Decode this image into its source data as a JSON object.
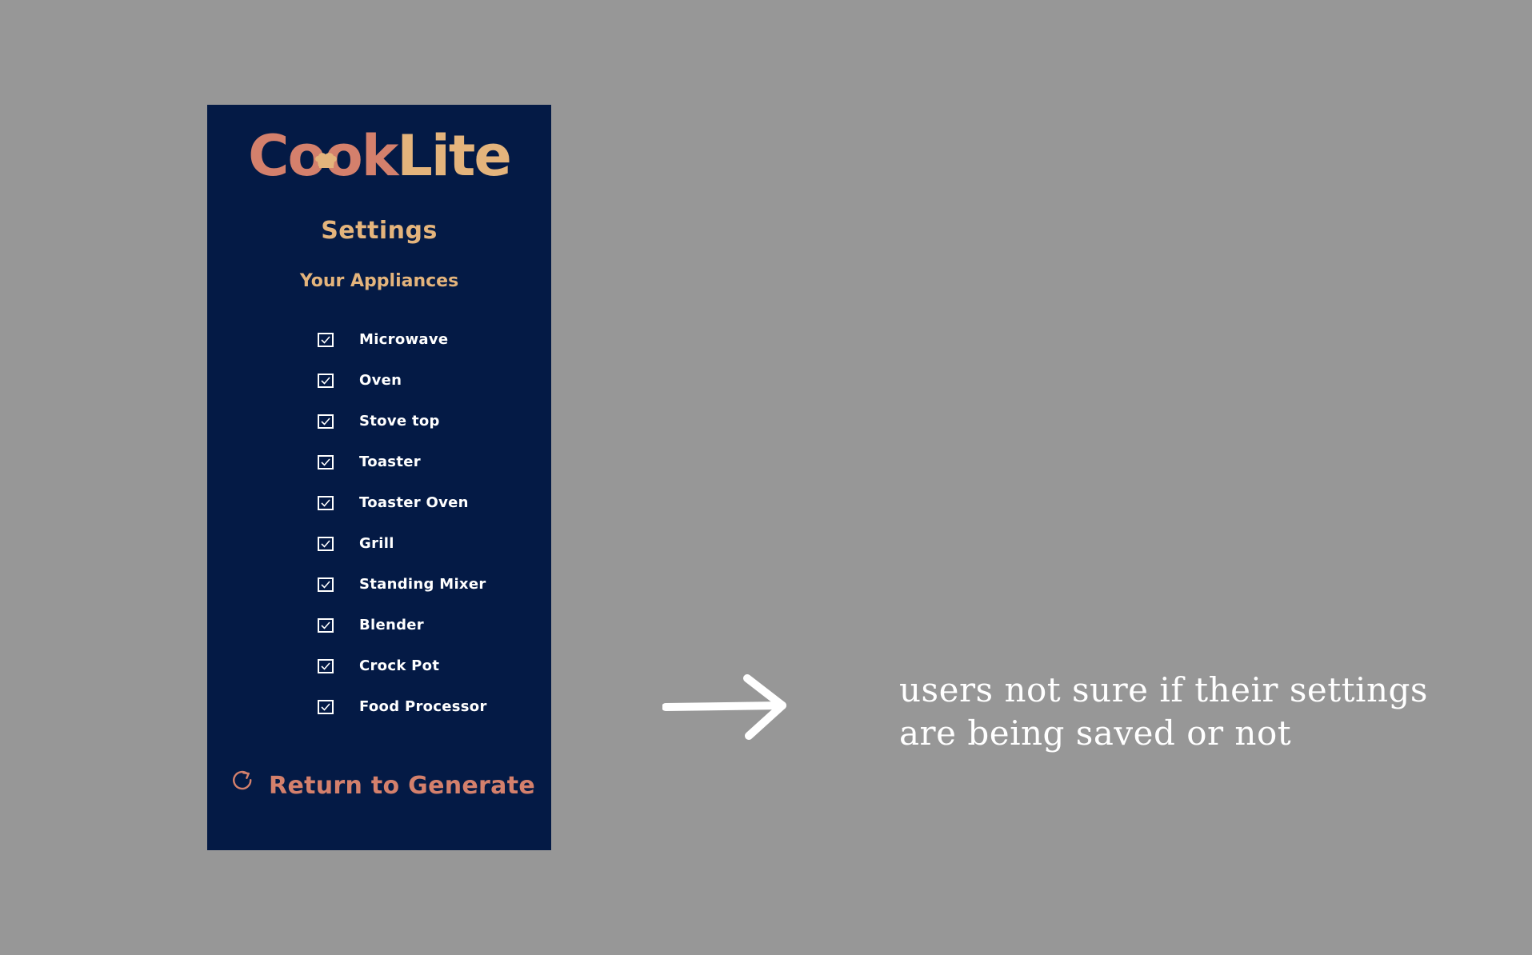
{
  "app": {
    "logo_part1": "Cook",
    "logo_part2": "Lite"
  },
  "settings": {
    "title": "Settings",
    "section_title": "Your Appliances",
    "appliances": [
      {
        "label": "Microwave",
        "checked": true
      },
      {
        "label": "Oven",
        "checked": true
      },
      {
        "label": "Stove top",
        "checked": true
      },
      {
        "label": "Toaster",
        "checked": true
      },
      {
        "label": "Toaster Oven",
        "checked": true
      },
      {
        "label": "Grill",
        "checked": true
      },
      {
        "label": "Standing Mixer",
        "checked": true
      },
      {
        "label": "Blender",
        "checked": true
      },
      {
        "label": "Crock Pot",
        "checked": true
      },
      {
        "label": "Food Processor",
        "checked": true
      }
    ],
    "return_label": "Return to Generate"
  },
  "annotation": {
    "line1": "users not sure if their settings",
    "line2": "are being saved or not"
  },
  "colors": {
    "background": "#979797",
    "panel": "#041a45",
    "accent_coral": "#d4806c",
    "accent_gold": "#e4b47c"
  },
  "icons": {
    "logo_hat": "chef-hat-icon",
    "checkbox": "checkbox-checked-icon",
    "return": "refresh-icon",
    "arrow": "arrow-right-icon"
  }
}
